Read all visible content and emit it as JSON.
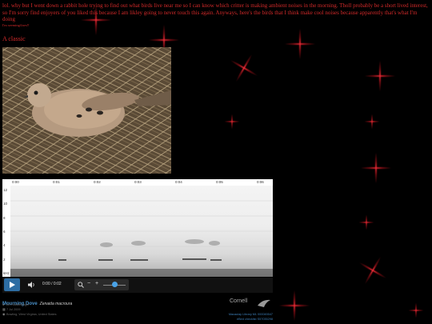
{
  "post": {
    "intro": "lol. why but I went down a rabbit hole trying to find out what birds live near me so I can know which critter is making ambient noises in the morning. Tholl probably be a short lived interest, so I'm sorry find enjoyers of you liked this because I am likley going to never touch this again. Anyways, here's the birds that I think make cool noises because apparently that's what I'm doing",
    "byline": "I'm seeming/favs!!",
    "heading": "A classic"
  },
  "spectrogram": {
    "time_ticks": [
      "0:00",
      "0:01",
      "0:02",
      "0:03",
      "0:04",
      "0:05",
      "0:06"
    ],
    "freq_ticks": [
      "12",
      "10",
      "8",
      "6",
      "4",
      "2",
      "kHz"
    ]
  },
  "player": {
    "time": "0:00 / 0:02",
    "zoom_level": 0.5
  },
  "species": {
    "common_name": "Mourning Dove",
    "scientific_name": "Zenaida macroura",
    "recordist": "Art Huckleberger",
    "date": "7 Jul 2009",
    "location": "Bowling, West Virginia, United States"
  },
  "credits": {
    "brand": "Cornell",
    "ml_id": "Macaulay Library ML 000045547",
    "checklist": "eBird checklist S57035298"
  },
  "colors": {
    "accent_text": "#d42a2a",
    "play_button": "#2d6da3",
    "link": "#4a90c8"
  }
}
